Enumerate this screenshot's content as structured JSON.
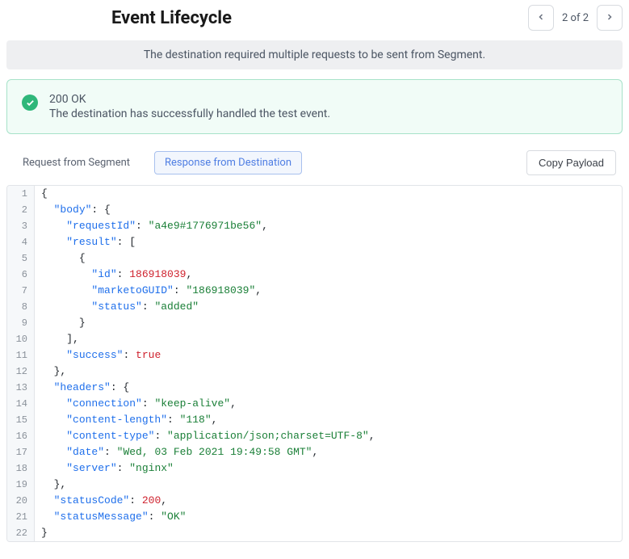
{
  "header": {
    "title": "Event Lifecycle",
    "pager_text": "2 of 2"
  },
  "notice": {
    "text": "The destination required multiple requests to be sent from Segment."
  },
  "status": {
    "title": "200 OK",
    "description": "The destination has successfully handled the test event."
  },
  "toolbar": {
    "tab_request": "Request from Segment",
    "tab_response": "Response from Destination",
    "copy_label": "Copy Payload"
  },
  "response_payload": {
    "body": {
      "requestId": "a4e9#1776971be56",
      "result": [
        {
          "id": 186918039,
          "marketoGUID": "186918039",
          "status": "added"
        }
      ],
      "success": true
    },
    "headers": {
      "connection": "keep-alive",
      "content-length": "118",
      "content-type": "application/json;charset=UTF-8",
      "date": "Wed, 03 Feb 2021 19:49:58 GMT",
      "server": "nginx"
    },
    "statusCode": 200,
    "statusMessage": "OK"
  },
  "code_lines": [
    [
      {
        "t": "punc",
        "v": "{"
      }
    ],
    [
      {
        "t": "ind",
        "v": "  "
      },
      {
        "t": "key",
        "v": "\"body\""
      },
      {
        "t": "punc",
        "v": ": {"
      }
    ],
    [
      {
        "t": "ind",
        "v": "    "
      },
      {
        "t": "key",
        "v": "\"requestId\""
      },
      {
        "t": "punc",
        "v": ": "
      },
      {
        "t": "str",
        "v": "\"a4e9#1776971be56\""
      },
      {
        "t": "punc",
        "v": ","
      }
    ],
    [
      {
        "t": "ind",
        "v": "    "
      },
      {
        "t": "key",
        "v": "\"result\""
      },
      {
        "t": "punc",
        "v": ": ["
      }
    ],
    [
      {
        "t": "ind",
        "v": "      "
      },
      {
        "t": "punc",
        "v": "{"
      }
    ],
    [
      {
        "t": "ind",
        "v": "        "
      },
      {
        "t": "key",
        "v": "\"id\""
      },
      {
        "t": "punc",
        "v": ": "
      },
      {
        "t": "num",
        "v": "186918039"
      },
      {
        "t": "punc",
        "v": ","
      }
    ],
    [
      {
        "t": "ind",
        "v": "        "
      },
      {
        "t": "key",
        "v": "\"marketoGUID\""
      },
      {
        "t": "punc",
        "v": ": "
      },
      {
        "t": "str",
        "v": "\"186918039\""
      },
      {
        "t": "punc",
        "v": ","
      }
    ],
    [
      {
        "t": "ind",
        "v": "        "
      },
      {
        "t": "key",
        "v": "\"status\""
      },
      {
        "t": "punc",
        "v": ": "
      },
      {
        "t": "str",
        "v": "\"added\""
      }
    ],
    [
      {
        "t": "ind",
        "v": "      "
      },
      {
        "t": "punc",
        "v": "}"
      }
    ],
    [
      {
        "t": "ind",
        "v": "    "
      },
      {
        "t": "punc",
        "v": "],"
      }
    ],
    [
      {
        "t": "ind",
        "v": "    "
      },
      {
        "t": "key",
        "v": "\"success\""
      },
      {
        "t": "punc",
        "v": ": "
      },
      {
        "t": "bool",
        "v": "true"
      }
    ],
    [
      {
        "t": "ind",
        "v": "  "
      },
      {
        "t": "punc",
        "v": "},"
      }
    ],
    [
      {
        "t": "ind",
        "v": "  "
      },
      {
        "t": "key",
        "v": "\"headers\""
      },
      {
        "t": "punc",
        "v": ": {"
      }
    ],
    [
      {
        "t": "ind",
        "v": "    "
      },
      {
        "t": "key",
        "v": "\"connection\""
      },
      {
        "t": "punc",
        "v": ": "
      },
      {
        "t": "str",
        "v": "\"keep-alive\""
      },
      {
        "t": "punc",
        "v": ","
      }
    ],
    [
      {
        "t": "ind",
        "v": "    "
      },
      {
        "t": "key",
        "v": "\"content-length\""
      },
      {
        "t": "punc",
        "v": ": "
      },
      {
        "t": "str",
        "v": "\"118\""
      },
      {
        "t": "punc",
        "v": ","
      }
    ],
    [
      {
        "t": "ind",
        "v": "    "
      },
      {
        "t": "key",
        "v": "\"content-type\""
      },
      {
        "t": "punc",
        "v": ": "
      },
      {
        "t": "str",
        "v": "\"application/json;charset=UTF-8\""
      },
      {
        "t": "punc",
        "v": ","
      }
    ],
    [
      {
        "t": "ind",
        "v": "    "
      },
      {
        "t": "key",
        "v": "\"date\""
      },
      {
        "t": "punc",
        "v": ": "
      },
      {
        "t": "str",
        "v": "\"Wed, 03 Feb 2021 19:49:58 GMT\""
      },
      {
        "t": "punc",
        "v": ","
      }
    ],
    [
      {
        "t": "ind",
        "v": "    "
      },
      {
        "t": "key",
        "v": "\"server\""
      },
      {
        "t": "punc",
        "v": ": "
      },
      {
        "t": "str",
        "v": "\"nginx\""
      }
    ],
    [
      {
        "t": "ind",
        "v": "  "
      },
      {
        "t": "punc",
        "v": "},"
      }
    ],
    [
      {
        "t": "ind",
        "v": "  "
      },
      {
        "t": "key",
        "v": "\"statusCode\""
      },
      {
        "t": "punc",
        "v": ": "
      },
      {
        "t": "num",
        "v": "200"
      },
      {
        "t": "punc",
        "v": ","
      }
    ],
    [
      {
        "t": "ind",
        "v": "  "
      },
      {
        "t": "key",
        "v": "\"statusMessage\""
      },
      {
        "t": "punc",
        "v": ": "
      },
      {
        "t": "str",
        "v": "\"OK\""
      }
    ],
    [
      {
        "t": "punc",
        "v": "}"
      }
    ]
  ]
}
